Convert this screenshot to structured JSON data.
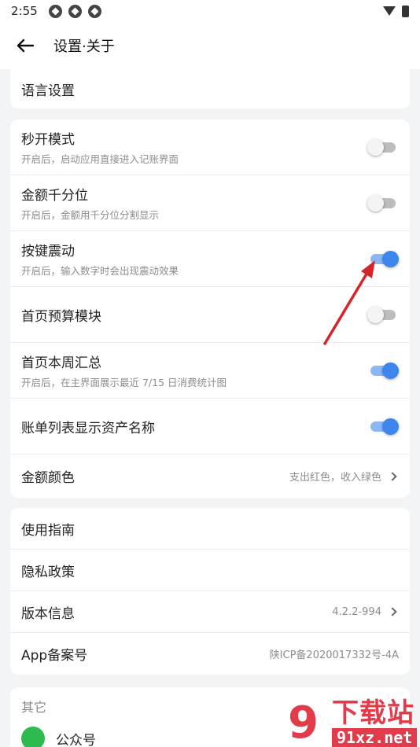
{
  "status_bar": {
    "time": "2:55"
  },
  "app_bar": {
    "title": "设置·关于"
  },
  "section1": {
    "language_label": "语言设置"
  },
  "section2": {
    "rows": [
      {
        "label": "秒开模式",
        "desc": "开启后，启动应用直接进入记账界面",
        "on": false
      },
      {
        "label": "金额千分位",
        "desc": "开启后，金额用千分位分割显示",
        "on": false
      },
      {
        "label": "按键震动",
        "desc": "开启后，输入数字时会出现震动效果",
        "on": true
      },
      {
        "label": "首页预算模块",
        "desc": "",
        "on": false
      },
      {
        "label": "首页本周汇总",
        "desc": "开启后，在主界面展示最近 7/15 日消费统计图",
        "on": true
      },
      {
        "label": "账单列表显示资产名称",
        "desc": "",
        "on": true
      }
    ],
    "color_row": {
      "label": "金额颜色",
      "value": "支出红色，收入绿色"
    }
  },
  "section3": {
    "guide_label": "使用指南",
    "privacy_label": "隐私政策",
    "version_label": "版本信息",
    "version_value": "4.2.2-994",
    "icp_label": "App备案号",
    "icp_value": "陕ICP备2020017332号-4A"
  },
  "section4": {
    "header": "其它",
    "wechat_label": "公众号"
  },
  "watermark": {
    "top": "下载站",
    "bottom": "91xz.net",
    "logo": "9"
  },
  "colors": {
    "accent": "#3d86ee",
    "arrow": "#d7232a",
    "watermark": "#e23b4a"
  }
}
